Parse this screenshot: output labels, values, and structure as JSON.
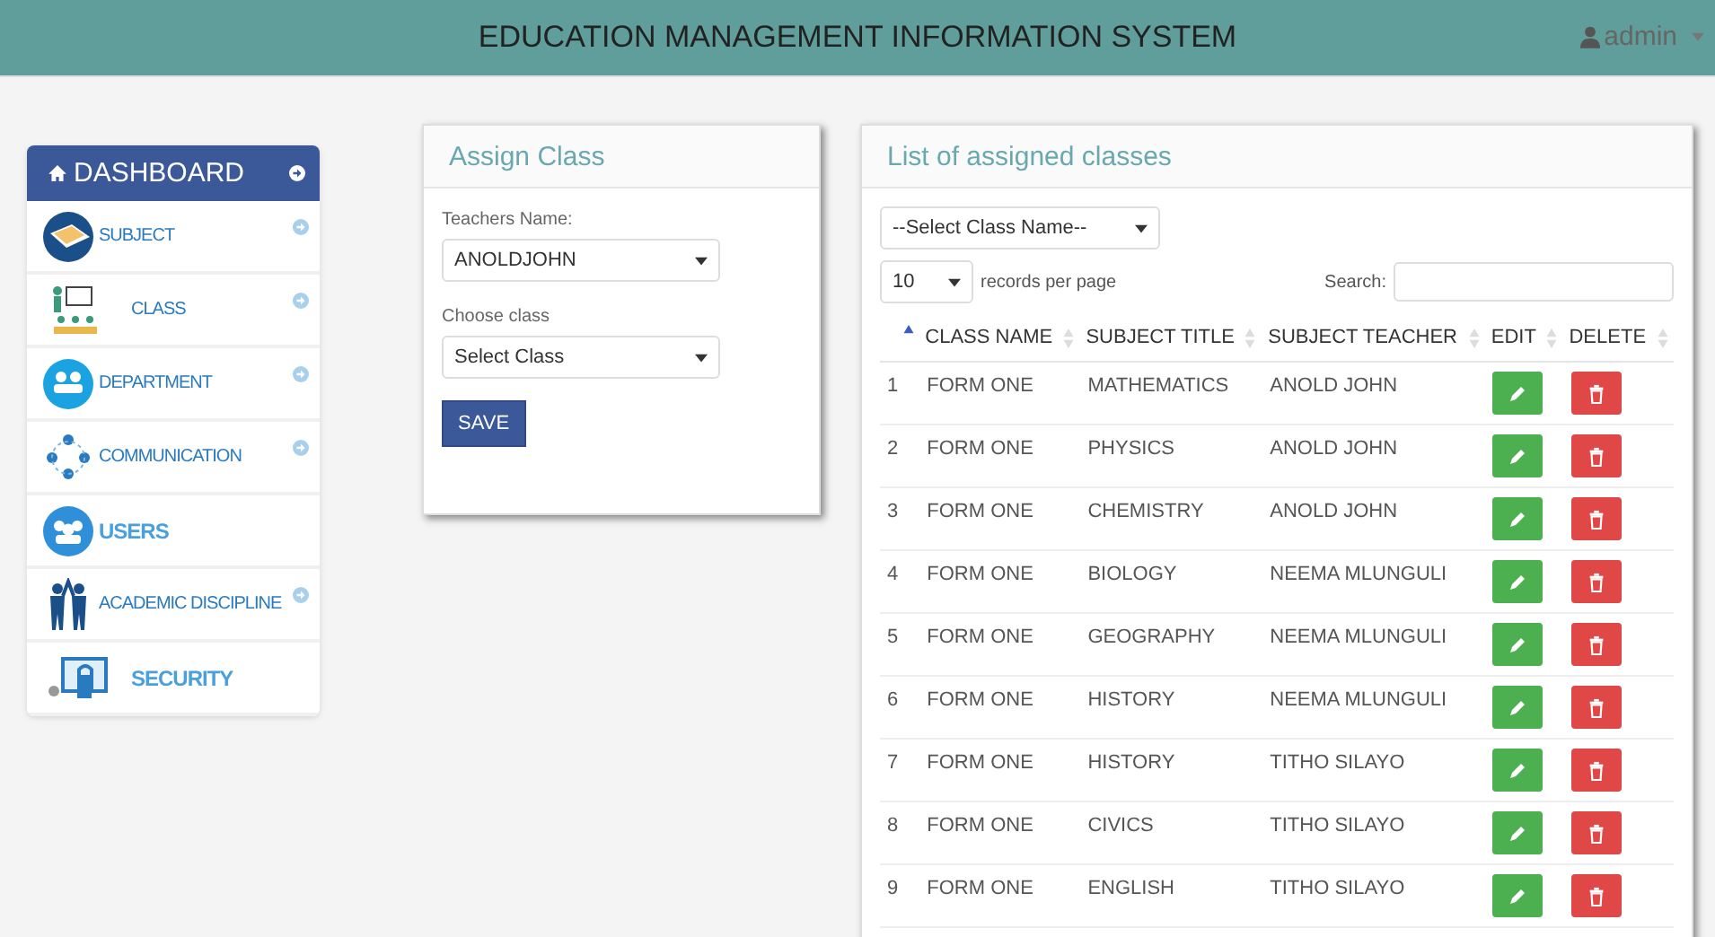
{
  "header": {
    "title": "EDUCATION MANAGEMENT INFORMATION SYSTEM",
    "user": "admin"
  },
  "sidebar": {
    "title": "DASHBOARD",
    "items": [
      {
        "label": "SUBJECT",
        "kind": "book",
        "arrow": true,
        "bold": false
      },
      {
        "label": "CLASS",
        "kind": "teacher",
        "arrow": true,
        "bold": false
      },
      {
        "label": "DEPARTMENT",
        "kind": "group",
        "arrow": true,
        "bold": false
      },
      {
        "label": "COMMUNICATION",
        "kind": "network",
        "arrow": true,
        "bold": false
      },
      {
        "label": "USERS",
        "kind": "users",
        "arrow": false,
        "bold": true
      },
      {
        "label": "ACADEMIC DISCIPLINE",
        "kind": "people",
        "arrow": true,
        "bold": false
      },
      {
        "label": "SECURITY",
        "kind": "lock",
        "arrow": false,
        "bold": true
      }
    ]
  },
  "assign": {
    "title": "Assign Class",
    "teacher_label": "Teachers Name:",
    "teacher_value": "ANOLDJOHN",
    "class_label": "Choose class",
    "class_value": "Select Class",
    "save": "SAVE"
  },
  "list": {
    "title": "List of assigned classes",
    "filter": "--Select Class Name--",
    "page_size": "10",
    "page_size_label": "records per page",
    "search_label": "Search:",
    "columns": [
      {
        "sorted": true
      },
      {
        "label": "CLASS NAME",
        "sorted": false
      },
      {
        "label": "SUBJECT TITLE",
        "sorted": false
      },
      {
        "label": "SUBJECT TEACHER",
        "sorted": false
      },
      {
        "label": "EDIT",
        "sorted": false
      },
      {
        "label": "DELETE",
        "sorted": false
      }
    ],
    "rows": [
      {
        "no": "1",
        "class": "FORM ONE",
        "subject": "MATHEMATICS",
        "teacher": "ANOLD JOHN"
      },
      {
        "no": "2",
        "class": "FORM ONE",
        "subject": "PHYSICS",
        "teacher": "ANOLD JOHN"
      },
      {
        "no": "3",
        "class": "FORM ONE",
        "subject": "CHEMISTRY",
        "teacher": "ANOLD JOHN"
      },
      {
        "no": "4",
        "class": "FORM ONE",
        "subject": "BIOLOGY",
        "teacher": "NEEMA MLUNGULI"
      },
      {
        "no": "5",
        "class": "FORM ONE",
        "subject": "GEOGRAPHY",
        "teacher": "NEEMA MLUNGULI"
      },
      {
        "no": "6",
        "class": "FORM ONE",
        "subject": "HISTORY",
        "teacher": "NEEMA MLUNGULI"
      },
      {
        "no": "7",
        "class": "FORM ONE",
        "subject": "HISTORY",
        "teacher": "TITHO SILAYO"
      },
      {
        "no": "8",
        "class": "FORM ONE",
        "subject": "CIVICS",
        "teacher": "TITHO SILAYO"
      },
      {
        "no": "9",
        "class": "FORM ONE",
        "subject": "ENGLISH",
        "teacher": "TITHO SILAYO"
      }
    ]
  }
}
